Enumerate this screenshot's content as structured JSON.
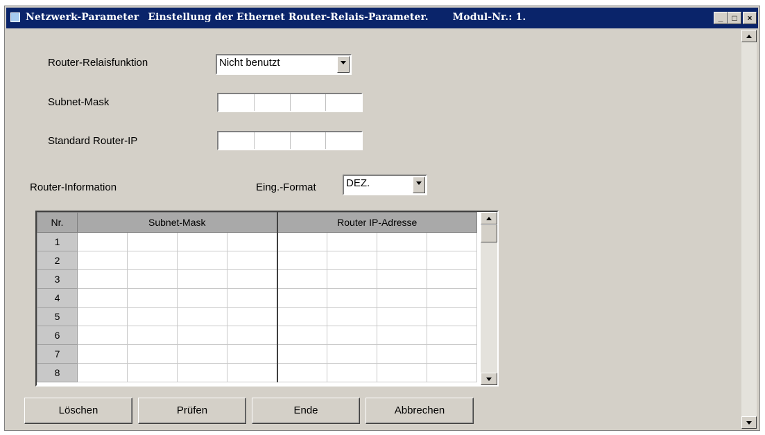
{
  "window": {
    "title_parts": [
      "Netzwerk-Parameter",
      "Einstellung der Ethernet Router-Relais-Parameter.",
      "Modul-Nr.: 1."
    ],
    "controls": {
      "minimize": "_",
      "maximize": "□",
      "close": "×"
    }
  },
  "form": {
    "relay_label": "Router-Relaisfunktion",
    "relay_value": "Nicht benutzt",
    "subnet_label": "Subnet-Mask",
    "router_ip_label": "Standard Router-IP"
  },
  "router_info": {
    "label": "Router-Information",
    "format_label": "Eing.-Format",
    "format_value": "DEZ."
  },
  "table": {
    "headers": {
      "nr": "Nr.",
      "subnet": "Subnet-Mask",
      "router_ip": "Router IP-Adresse"
    },
    "rows": [
      "1",
      "2",
      "3",
      "4",
      "5",
      "6",
      "7",
      "8"
    ]
  },
  "buttons": {
    "delete": "Löschen",
    "check": "Prüfen",
    "end": "Ende",
    "cancel": "Abbrechen"
  }
}
